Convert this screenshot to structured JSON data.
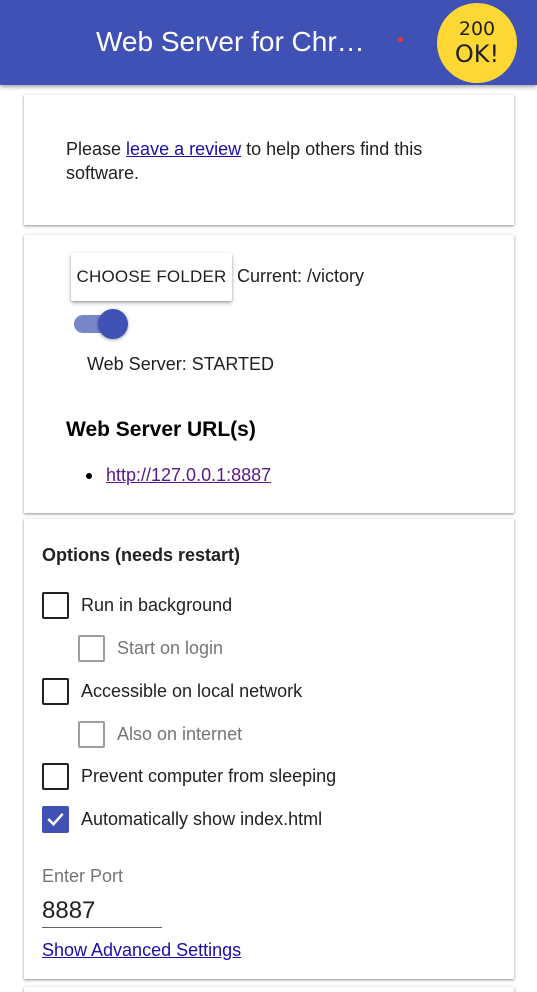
{
  "appbar": {
    "title": "Web Server for Chr…",
    "logo_text_line1": "200",
    "logo_text_line2": "OK!",
    "primary_color": "#3f51b5",
    "logo_color": "#fdd835"
  },
  "review": {
    "prefix": "Please ",
    "link_text": "leave a review",
    "suffix": " to help others find this software."
  },
  "server": {
    "choose_folder_label": "CHOOSE FOLDER",
    "current_folder": "Current: /victory",
    "toggle_on": true,
    "status": "Web Server: STARTED",
    "urls_heading": "Web Server URL(s)",
    "urls": [
      "http://127.0.0.1:8887"
    ]
  },
  "options": {
    "heading": "Options (needs restart)",
    "items": [
      {
        "label": "Run in background",
        "checked": false,
        "disabled": false
      },
      {
        "label": "Start on login",
        "checked": false,
        "disabled": true
      },
      {
        "label": "Accessible on local network",
        "checked": false,
        "disabled": false
      },
      {
        "label": "Also on internet",
        "checked": false,
        "disabled": true
      },
      {
        "label": "Prevent computer from sleeping",
        "checked": false,
        "disabled": false
      },
      {
        "label": "Automatically show index.html",
        "checked": true,
        "disabled": false
      }
    ],
    "port_label": "Enter Port",
    "port_value": "8887",
    "advanced_link": "Show Advanced Settings"
  }
}
